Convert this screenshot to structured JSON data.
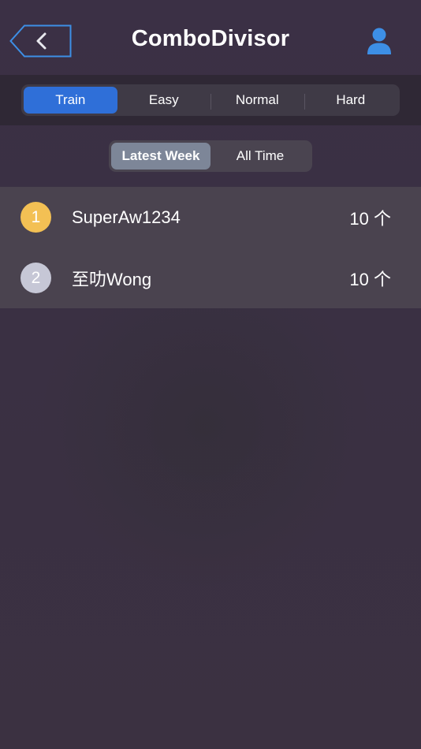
{
  "header": {
    "title": "ComboDivisor",
    "back_icon": "chevron-left-icon",
    "user_icon": "user-icon"
  },
  "difficulty_tabs": [
    {
      "label": "Train",
      "active": true
    },
    {
      "label": "Easy",
      "active": false
    },
    {
      "label": "Normal",
      "active": false
    },
    {
      "label": "Hard",
      "active": false
    }
  ],
  "period_tabs": [
    {
      "label": "Latest Week",
      "active": true
    },
    {
      "label": "All Time",
      "active": false
    }
  ],
  "leaderboard": [
    {
      "rank": "1",
      "name": "SuperAw1234",
      "score": "10 个"
    },
    {
      "rank": "2",
      "name": "至叻Wong",
      "score": "10 个"
    }
  ],
  "colors": {
    "accent_blue": "#2f6fd8",
    "rank_gold": "#f3c054",
    "rank_silver": "#c6c7d6",
    "icon_blue": "#3d8fe6"
  }
}
